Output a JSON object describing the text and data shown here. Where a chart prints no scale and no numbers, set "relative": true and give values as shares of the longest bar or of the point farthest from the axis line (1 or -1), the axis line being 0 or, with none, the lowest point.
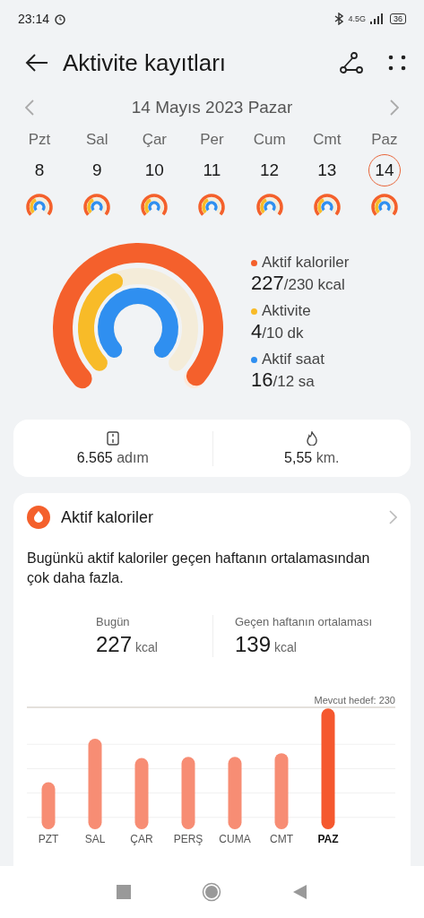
{
  "status_bar": {
    "time": "23:14",
    "network": "4.5G",
    "battery": "36"
  },
  "header": {
    "title": "Aktivite kayıtları"
  },
  "date_nav": {
    "label": "14 Mayıs 2023 Pazar"
  },
  "week": [
    {
      "weekday": "Pzt",
      "day": "8",
      "selected": false
    },
    {
      "weekday": "Sal",
      "day": "9",
      "selected": false
    },
    {
      "weekday": "Çar",
      "day": "10",
      "selected": false
    },
    {
      "weekday": "Per",
      "day": "11",
      "selected": false
    },
    {
      "weekday": "Cum",
      "day": "12",
      "selected": false
    },
    {
      "weekday": "Cmt",
      "day": "13",
      "selected": false
    },
    {
      "weekday": "Paz",
      "day": "14",
      "selected": true
    }
  ],
  "summary": {
    "metrics": [
      {
        "name": "Aktif kaloriler",
        "value": "227",
        "goal": "/230 kcal",
        "color": "#f4602c"
      },
      {
        "name": "Aktivite",
        "value": "4",
        "goal": "/10 dk",
        "color": "#f8bb28"
      },
      {
        "name": "Aktif saat",
        "value": "16",
        "goal": "/12 sa",
        "color": "#2f8ff0"
      }
    ]
  },
  "stats": [
    {
      "kind": "steps",
      "value": "6.565",
      "unit": "adım"
    },
    {
      "kind": "distance",
      "value": "5,55",
      "unit": "km."
    }
  ],
  "calories_card": {
    "title": "Aktif kaloriler",
    "message": "Bugünkü aktif kaloriler geçen haftanın ortalamasından çok daha fazla.",
    "comparison": [
      {
        "label": "Bugün",
        "value": "227",
        "unit": "kcal"
      },
      {
        "label": "Geçen haftanın ortalaması",
        "value": "139",
        "unit": "kcal"
      }
    ],
    "goal_label": "Mevcut hedef: 230",
    "category_selected": [
      false,
      false,
      false,
      false,
      false,
      false,
      true
    ],
    "chart_data": {
      "type": "bar",
      "relative": true,
      "categories": [
        "PZT",
        "SAL",
        "ÇAR",
        "PERŞ",
        "CUMA",
        "CMT",
        "PAZ"
      ],
      "values": [
        0.39,
        0.75,
        0.59,
        0.6,
        0.6,
        0.63,
        1
      ]
    }
  }
}
